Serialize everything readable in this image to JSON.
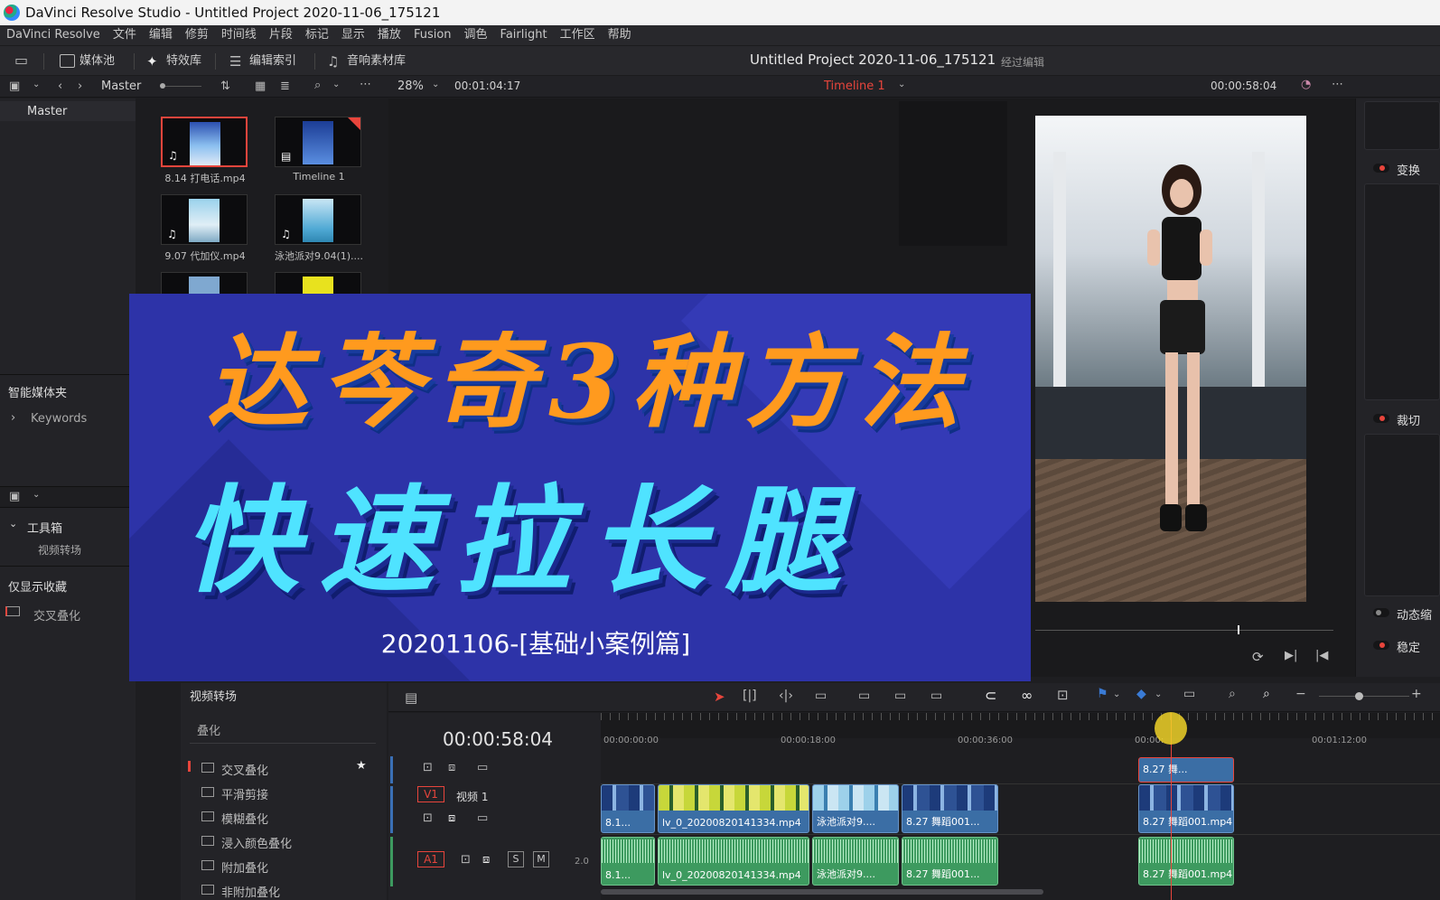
{
  "window": {
    "title": "DaVinci Resolve Studio - Untitled Project 2020-11-06_175121"
  },
  "menu": [
    "DaVinci Resolve",
    "文件",
    "编辑",
    "修剪",
    "时间线",
    "片段",
    "标记",
    "显示",
    "播放",
    "Fusion",
    "调色",
    "Fairlight",
    "工作区",
    "帮助"
  ],
  "toolbar": {
    "media_pool": "媒体池",
    "effects": "特效库",
    "edit_index": "编辑索引",
    "sound_library": "音响素材库",
    "project_title": "Untitled Project 2020-11-06_175121",
    "project_status": "经过编辑"
  },
  "subbar": {
    "bin": "Master",
    "zoom": "28%",
    "source_tc": "00:01:04:17",
    "timeline_name": "Timeline 1",
    "record_tc": "00:00:58:04"
  },
  "left": {
    "master": "Master",
    "smart_bins": "智能媒体夹",
    "keywords": "Keywords",
    "toolbox": "工具箱",
    "video_transitions": "视频转场",
    "favorites": "仅显示收藏",
    "fav_item": "交叉叠化"
  },
  "media": [
    {
      "name": "8.14 打电话.mp4",
      "selected": true
    },
    {
      "name": "Timeline 1",
      "selected": false
    },
    {
      "name": "9.07 代加仪.mp4",
      "selected": false
    },
    {
      "name": "泳池派对9.04(1)....",
      "selected": false
    }
  ],
  "banner": {
    "line1": "达芩奇3种方法",
    "line2": "快速拉长腿",
    "line3": "20201106-[基础小案例篇]"
  },
  "inspector": {
    "transform": "变换",
    "crop": "裁切",
    "dynamic_zoom": "动态缩",
    "stabilize": "稳定"
  },
  "effects_panel": {
    "header": "视频转场",
    "group": "叠化",
    "items": [
      "交叉叠化",
      "平滑剪接",
      "模糊叠化",
      "浸入颜色叠化",
      "附加叠化",
      "非附加叠化"
    ]
  },
  "timeline": {
    "timecode": "00:00:58:04",
    "ruler": [
      "00:00:00:00",
      "00:00:18:00",
      "00:00:36:00",
      "00:00:",
      "00:01:12:00"
    ],
    "v1_label": "V1",
    "v1_name": "视频 1",
    "a1_label": "A1",
    "a1_level": "2.0",
    "solo": "S",
    "mute": "M",
    "v2_clips": [
      "8.27 舞..."
    ],
    "v1_clips": [
      "8.1...",
      "lv_0_20200820141334.mp4",
      "泳池派对9....",
      "8.27 舞蹈001...",
      "8.27 舞蹈001.mp4"
    ],
    "a1_clips": [
      "8.1...",
      "lv_0_20200820141334.mp4",
      "泳池派对9....",
      "8.27 舞蹈001...",
      "8.27 舞蹈001.mp4"
    ]
  },
  "colors": {
    "accent": "#e8453c",
    "video_clip": "#3b6ea5",
    "audio_clip": "#3d9a5f",
    "banner_bg": "#2d33a8",
    "banner_orange": "#ff9a1e",
    "banner_cyan": "#4fe3ff"
  }
}
